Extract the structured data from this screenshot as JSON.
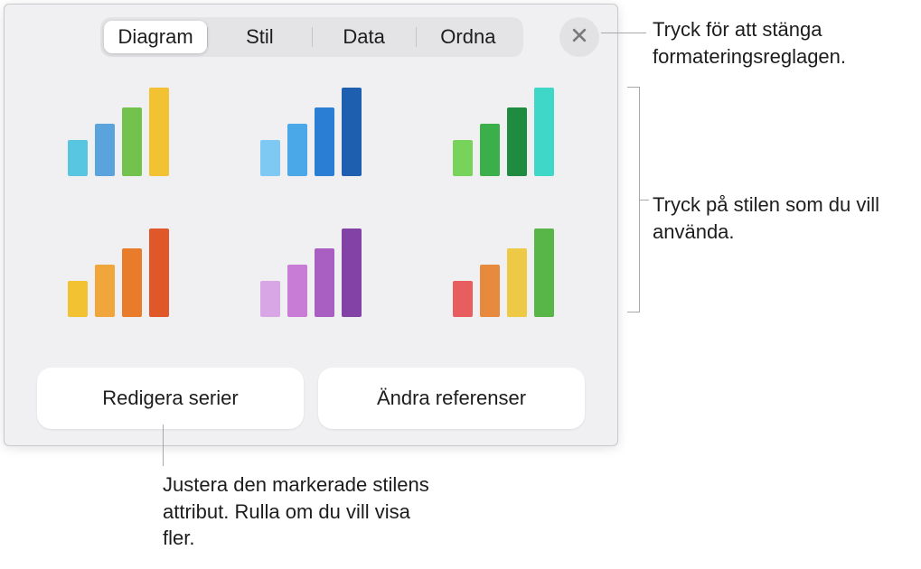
{
  "tabs": {
    "diagram": "Diagram",
    "stil": "Stil",
    "data": "Data",
    "ordna": "Ordna"
  },
  "buttons": {
    "edit_series": "Redigera serier",
    "change_references": "Ändra referenser"
  },
  "callouts": {
    "close": "Tryck för att stänga formateringsreglagen.",
    "styles": "Tryck på stilen som du vill använda.",
    "edit": "Justera den markerade stilens attribut. Rulla om du vill visa fler."
  },
  "bar_heights": [
    40,
    58,
    76,
    98
  ],
  "style_palettes": [
    [
      "#58c6e0",
      "#5aa3dc",
      "#72c24d",
      "#f2c232"
    ],
    [
      "#7ec8f4",
      "#4aa8e8",
      "#2a7fd4",
      "#1f5fb0"
    ],
    [
      "#78d35a",
      "#3bb04a",
      "#1f8b3f",
      "#3fd8c8"
    ],
    [
      "#f2c232",
      "#f0a63a",
      "#e87c2a",
      "#e0582a"
    ],
    [
      "#d8a6e4",
      "#c87cd6",
      "#a95fc2",
      "#8343a6"
    ],
    [
      "#e85e5e",
      "#e88a3e",
      "#eec946",
      "#58b648"
    ]
  ]
}
